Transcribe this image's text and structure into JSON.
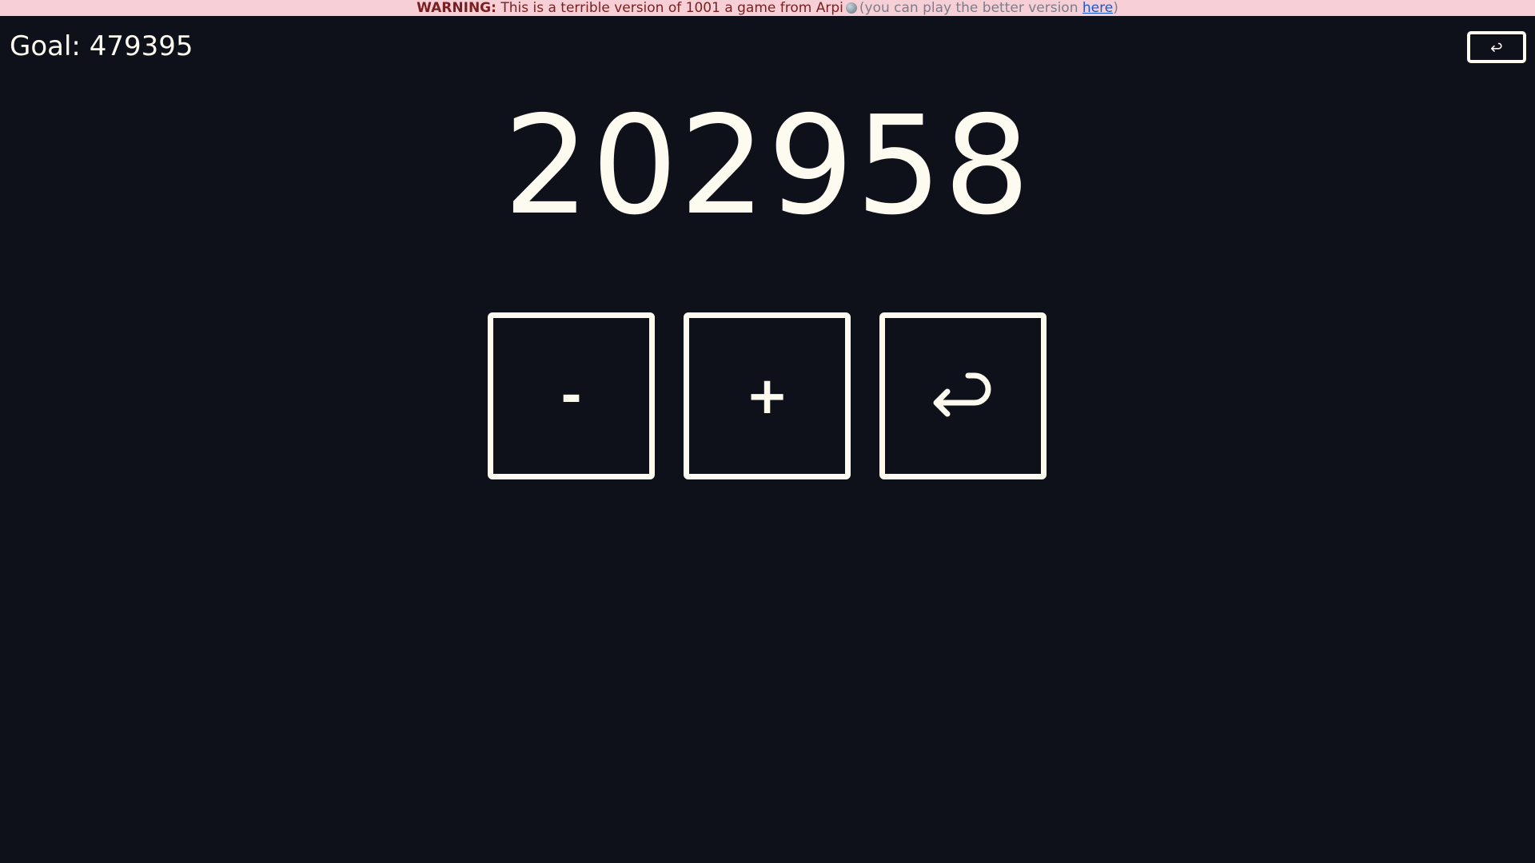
{
  "warning": {
    "label": "WARNING:",
    "text": "This is a terrible version of 1001 a game from Arpi",
    "aside_prefix": "(you can play the better version ",
    "link_text": "here",
    "aside_suffix": ")"
  },
  "goal": {
    "label": "Goal:",
    "value": "479395"
  },
  "current": {
    "value": "202958"
  },
  "controls": {
    "minus_label": "-",
    "plus_label": "+"
  },
  "icons": {
    "undo": "return-arrow-icon",
    "globe": "globe-icon"
  },
  "colors": {
    "background": "#0f111a",
    "foreground": "#fdfaf0",
    "warning_bg": "#f6d0d6",
    "warning_text": "#7a1f1f",
    "link": "#1a57d6"
  }
}
